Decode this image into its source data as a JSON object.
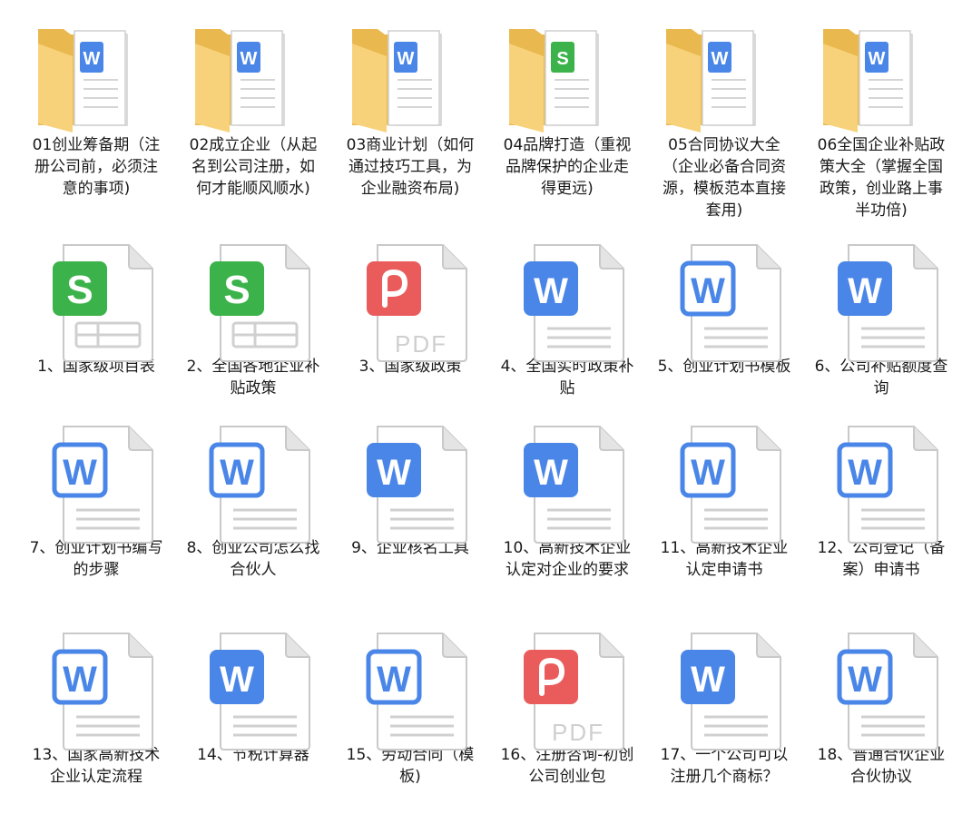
{
  "folders": [
    {
      "name": "01创业筹备期（注册公司前，必须注意的事项)",
      "doc": "word"
    },
    {
      "name": "02成立企业（从起名到公司注册，如何才能顺风顺水)",
      "doc": "word"
    },
    {
      "name": "03商业计划（如何通过技巧工具，为企业融资布局)",
      "doc": "word"
    },
    {
      "name": "04品牌打造（重视品牌保护的企业走得更远)",
      "doc": "excel"
    },
    {
      "name": "05合同协议大全（企业必备合同资源，模板范本直接套用)",
      "doc": "word"
    },
    {
      "name": "06全国企业补贴政策大全（掌握全国政策，创业路上事半功倍)",
      "doc": "word"
    }
  ],
  "files": [
    {
      "name": "1、国家级项目表",
      "type": "excel"
    },
    {
      "name": "2、全国各地企业补贴政策",
      "type": "excel"
    },
    {
      "name": "3、国家级政策",
      "type": "pdf"
    },
    {
      "name": "4、全国实时政策补贴",
      "type": "word-solid"
    },
    {
      "name": "5、创业计划书模板",
      "type": "word-outline"
    },
    {
      "name": "6、公司补贴额度查询",
      "type": "word-solid"
    },
    {
      "name": "7、创业计划书编写的步骤",
      "type": "word-outline"
    },
    {
      "name": "8、创业公司怎么找合伙人",
      "type": "word-outline"
    },
    {
      "name": "9、企业核名工具",
      "type": "word-solid"
    },
    {
      "name": "10、高新技术企业认定对企业的要求",
      "type": "word-solid"
    },
    {
      "name": "11、高新技术企业认定申请书",
      "type": "word-outline"
    },
    {
      "name": "12、公司登记（备案）申请书",
      "type": "word-outline"
    },
    {
      "name": "13、国家高新技术企业认定流程",
      "type": "word-outline"
    },
    {
      "name": "14、节税计算器",
      "type": "word-solid"
    },
    {
      "name": "15、劳动合同（模板)",
      "type": "word-outline"
    },
    {
      "name": "16、注册咨询-初创公司创业包",
      "type": "pdf"
    },
    {
      "name": "17、一个公司可以注册几个商标？",
      "type": "word-solid"
    },
    {
      "name": "18、普通合伙企业合伙协议",
      "type": "word-outline"
    }
  ],
  "icon_text": {
    "excel": "S",
    "word": "W",
    "pdf_label": "PDF"
  },
  "colors": {
    "folder_back": "#e9b94f",
    "folder_front": "#f8d27a",
    "excel": "#3bb34a",
    "word": "#4a86e8",
    "pdf": "#ea5c5c",
    "paper": "#ffffff",
    "paper_border": "#c9c9c9",
    "paper_fold": "#e4e4e4",
    "lines": "#d0d0d0"
  }
}
